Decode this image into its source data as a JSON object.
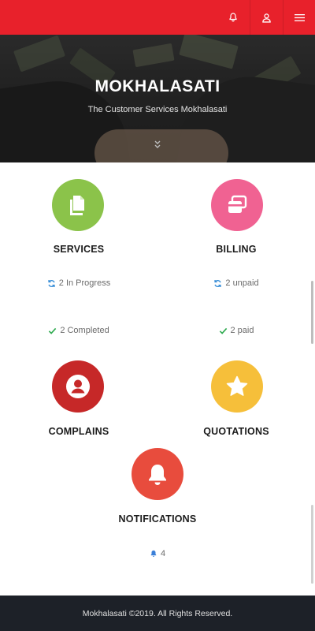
{
  "header": {
    "bell_icon": "bell-icon",
    "user_icon": "user-icon",
    "menu_icon": "hamburger-menu-icon",
    "color": "#e8212b"
  },
  "hero": {
    "title": "MOKHALASATI",
    "subtitle": "The Customer Services Mokhalasati"
  },
  "tiles": {
    "services": {
      "label": "SERVICES",
      "color": "#8bc34a",
      "stat1": "2 In Progress",
      "stat2": "2 Completed"
    },
    "billing": {
      "label": "BILLING",
      "color": "#f06292",
      "stat1": "2 unpaid",
      "stat2": "2 paid"
    },
    "complains": {
      "label": "COMPLAINS",
      "color": "#c62828"
    },
    "quotations": {
      "label": "QUOTATIONS",
      "color": "#f6bf3a"
    },
    "notifications": {
      "label": "NOTIFICATIONS",
      "color": "#e84c3d",
      "count": "4"
    }
  },
  "footer": {
    "text": "Mokhalasati ©2019. All Rights Reserved.",
    "color": "#1d2128"
  }
}
